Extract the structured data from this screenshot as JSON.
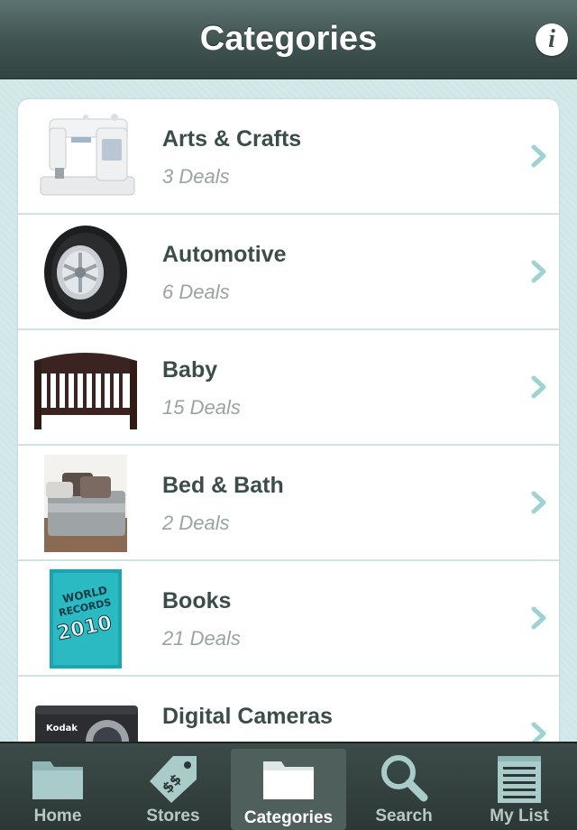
{
  "header": {
    "title": "Categories",
    "info_icon": "info-icon"
  },
  "colors": {
    "accent": "#9fd3d3",
    "title_text": "#3b4d4a",
    "deal_text": "#9aa3a2"
  },
  "categories": [
    {
      "title": "Arts & Crafts",
      "deals": "3 Deals",
      "image": "sewing-machine"
    },
    {
      "title": "Automotive",
      "deals": "6 Deals",
      "image": "tire"
    },
    {
      "title": "Baby",
      "deals": "15 Deals",
      "image": "crib"
    },
    {
      "title": "Bed & Bath",
      "deals": "2 Deals",
      "image": "bed"
    },
    {
      "title": "Books",
      "deals": "21 Deals",
      "image": "book"
    },
    {
      "title": "Digital Cameras",
      "deals": "",
      "image": "camera"
    }
  ],
  "book_cover_text": {
    "line1": "WORLD",
    "line2": "RECORDS",
    "year": "2010"
  },
  "camera_brand": "Kodak",
  "tab_bar": {
    "tabs": [
      {
        "label": "Home",
        "icon": "folder-icon"
      },
      {
        "label": "Stores",
        "icon": "price-tag-icon"
      },
      {
        "label": "Categories",
        "icon": "folder-icon",
        "active": true
      },
      {
        "label": "Search",
        "icon": "magnifier-icon"
      },
      {
        "label": "My List",
        "icon": "notepad-icon"
      }
    ]
  }
}
